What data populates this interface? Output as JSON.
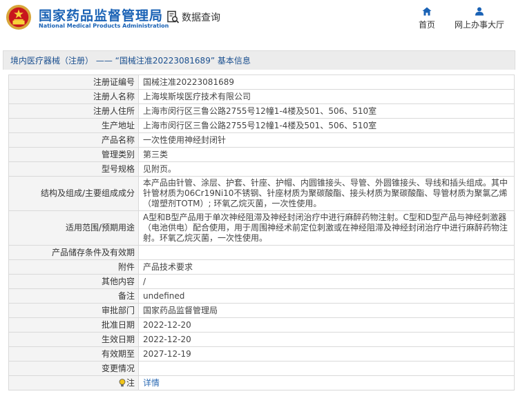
{
  "header": {
    "logo_cn": "国家药品监督管理局",
    "logo_en": "National Medical Products Administration",
    "search_label": "数据查询",
    "nav": {
      "home": "首页",
      "online_office": "网上办事大厅"
    }
  },
  "breadcrumb": {
    "text": "境内医疗器械（注册） —— “国械注准20223081689” 基本信息"
  },
  "rows": [
    {
      "label": "注册证编号",
      "value": "国械注准20223081689"
    },
    {
      "label": "注册人名称",
      "value": "上海埃斯埃医疗技术有限公司"
    },
    {
      "label": "注册人住所",
      "value": "上海市闵行区三鲁公路2755号12幢1-4楼及501、506、510室"
    },
    {
      "label": "生产地址",
      "value": "上海市闵行区三鲁公路2755号12幢1-4楼及501、506、510室"
    },
    {
      "label": "产品名称",
      "value": "一次性使用神经封闭针"
    },
    {
      "label": "管理类别",
      "value": "第三类"
    },
    {
      "label": "型号规格",
      "value": "见附页。"
    },
    {
      "label": "结构及组成/主要组成成分",
      "value": "本产品由针管、涂层、护套、针座、护帽、内圆锥接头、导管、外圆锥接头、导线和插头组成。其中针管材质为06Cr19Ni10不锈钢、针座材质为聚碳酸酯、接头材质为聚碳酸酯、导管材质为聚氯乙烯（增塑剂TOTM）; 环氧乙烷灭菌，一次性使用。"
    },
    {
      "label": "适用范围/预期用途",
      "value": "A型和B型产品用于单次神经阻滞及神经封闭治疗中进行麻醉药物注射。C型和D型产品与神经刺激器（电池供电）配合使用，用于周围神经术前定位刺激或在神经阻滞及神经封闭治疗中进行麻醉药物注射。环氧乙烷灭菌，一次性使用。"
    },
    {
      "label": "产品储存条件及有效期",
      "value": ""
    },
    {
      "label": "附件",
      "value": "产品技术要求"
    },
    {
      "label": "其他内容",
      "value": "/"
    },
    {
      "label": "备注",
      "value": "undefined"
    },
    {
      "label": "审批部门",
      "value": "国家药品监督管理局"
    },
    {
      "label": "批准日期",
      "value": "2022-12-20"
    },
    {
      "label": "生效日期",
      "value": "2022-12-20"
    },
    {
      "label": "有效期至",
      "value": "2027-12-19"
    },
    {
      "label": "变更情况",
      "value": ""
    }
  ],
  "note_row": {
    "label": "注",
    "link": "详情"
  },
  "colors": {
    "brand_blue": "#1a62b5",
    "link_blue": "#2b6ab3",
    "label_bg": "#f4f4f4"
  },
  "icons": {
    "search": "search-document-icon",
    "home": "home-icon",
    "office": "user-icon",
    "note": "lightbulb-icon"
  }
}
